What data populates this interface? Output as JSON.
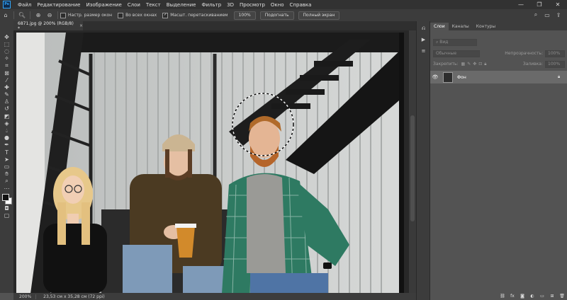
{
  "menu": {
    "logo": "Ps",
    "items": [
      "Файл",
      "Редактирование",
      "Изображение",
      "Слои",
      "Текст",
      "Выделение",
      "Фильтр",
      "3D",
      "Просмотр",
      "Окно",
      "Справка"
    ]
  },
  "window_controls": [
    "—",
    "❐",
    "✕"
  ],
  "options": {
    "check1": "Настр. размер окон",
    "check2": "Во всех окнах",
    "check3": "Масшт. перетаскиванием",
    "check3_checked": true,
    "zoom_btn": "100%",
    "fit_btn": "Подогнать",
    "fill_btn": "Полный экран"
  },
  "document": {
    "tab_title": "6871.jpg @ 200% (RGB/8) *",
    "close": "×"
  },
  "status": {
    "zoom": "200%",
    "info": "23,53 см x 35,28 см (72 ppi)"
  },
  "panel": {
    "tabs": [
      "Слои",
      "Каналы",
      "Контуры"
    ],
    "filter_placeholder": "Вид",
    "blend_mode": "Обычные",
    "opacity_label": "Непрозрачность:",
    "opacity_value": "100%",
    "lock_label": "Закрепить:",
    "fill_label": "Заливка:",
    "fill_value": "100%",
    "layer_name": "Фон"
  },
  "colors": {
    "accent": "#31a8ff",
    "foreground": "#111111",
    "background": "#ffffff"
  }
}
